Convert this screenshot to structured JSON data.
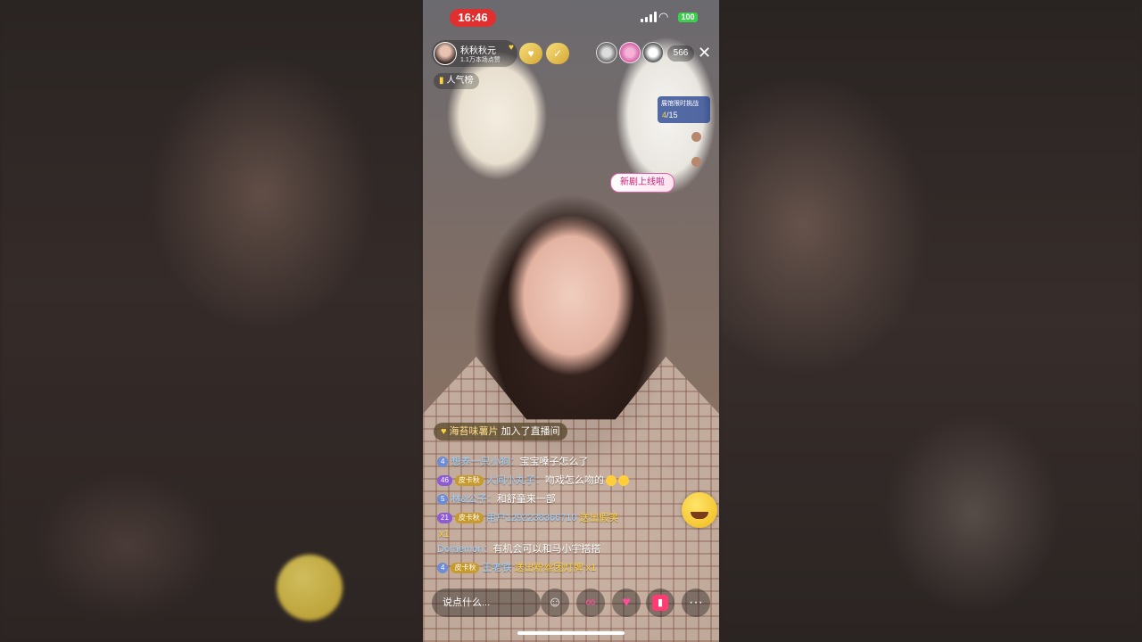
{
  "status_bar": {
    "time": "16:46",
    "battery": "100"
  },
  "host": {
    "name": "秋秋秋元",
    "likes": "1.1万本场点赞"
  },
  "header": {
    "viewer_count": "566",
    "rank_label": "人气榜"
  },
  "challenge": {
    "title": "展馆限时挑战",
    "current": "4",
    "total": "/15"
  },
  "banner": {
    "new_drama": "新剧上线啦"
  },
  "join": {
    "user": "海苔味薯片",
    "text": "加入了直播间"
  },
  "chat": [
    {
      "level": "4",
      "user": "想养一只小狗：",
      "text": "宝宝嗓子怎么了"
    },
    {
      "level": "46",
      "fan": "皮卡秋",
      "user": "人间小丸子：",
      "text": "吻戏怎么吻的"
    },
    {
      "level": "5",
      "user": "林&公子：",
      "text": "和舒童来一部"
    },
    {
      "level": "21",
      "fan": "皮卡秋",
      "user": "用户1292238366710",
      "gift": "送出假笑",
      "count": "x1"
    },
    {
      "user": "Doraemon：",
      "text": "有机会可以和马小宇搭搭"
    },
    {
      "level": "4",
      "fan": "皮卡秋",
      "user": "王老铁",
      "gift": "送出粉丝团灯牌",
      "count": "x1"
    }
  ],
  "bottom": {
    "say_placeholder": "说点什么..."
  },
  "icons": [
    "close-icon",
    "smile-icon",
    "link-icon",
    "heart-icon",
    "gift-icon",
    "more-icon"
  ]
}
